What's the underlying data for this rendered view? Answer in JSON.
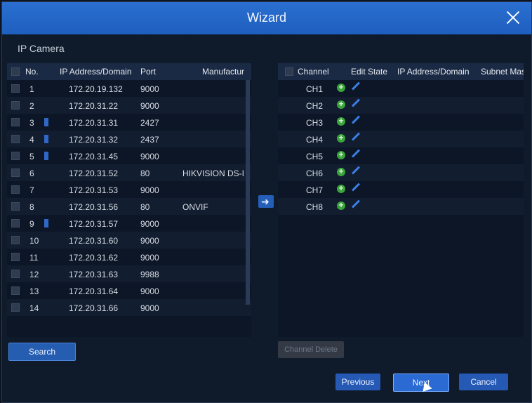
{
  "window": {
    "title": "Wizard"
  },
  "section_label": "IP Camera",
  "left_table": {
    "headers": [
      "No.",
      "IP Address/Domain",
      "Port",
      "Manufactur"
    ],
    "rows": [
      {
        "no": "1",
        "ip": "172.20.19.132",
        "port": "9000",
        "manufacturer": "",
        "badge": false
      },
      {
        "no": "2",
        "ip": "172.20.31.22",
        "port": "9000",
        "manufacturer": "",
        "badge": false
      },
      {
        "no": "3",
        "ip": "172.20.31.31",
        "port": "2427",
        "manufacturer": "",
        "badge": true
      },
      {
        "no": "4",
        "ip": "172.20.31.32",
        "port": "2437",
        "manufacturer": "",
        "badge": true
      },
      {
        "no": "5",
        "ip": "172.20.31.45",
        "port": "9000",
        "manufacturer": "",
        "badge": true
      },
      {
        "no": "6",
        "ip": "172.20.31.52",
        "port": "80",
        "manufacturer": "HIKVISION DS-I",
        "badge": false
      },
      {
        "no": "7",
        "ip": "172.20.31.53",
        "port": "9000",
        "manufacturer": "",
        "badge": false
      },
      {
        "no": "8",
        "ip": "172.20.31.56",
        "port": "80",
        "manufacturer": "ONVIF",
        "badge": false
      },
      {
        "no": "9",
        "ip": "172.20.31.57",
        "port": "9000",
        "manufacturer": "",
        "badge": true
      },
      {
        "no": "10",
        "ip": "172.20.31.60",
        "port": "9000",
        "manufacturer": "",
        "badge": false
      },
      {
        "no": "11",
        "ip": "172.20.31.62",
        "port": "9000",
        "manufacturer": "",
        "badge": false
      },
      {
        "no": "12",
        "ip": "172.20.31.63",
        "port": "9988",
        "manufacturer": "",
        "badge": false
      },
      {
        "no": "13",
        "ip": "172.20.31.64",
        "port": "9000",
        "manufacturer": "",
        "badge": false
      },
      {
        "no": "14",
        "ip": "172.20.31.66",
        "port": "9000",
        "manufacturer": "",
        "badge": false
      }
    ]
  },
  "right_table": {
    "headers": [
      "Channel",
      "Edit State",
      "IP Address/Domain",
      "Subnet Mas"
    ],
    "channels": [
      "CH1",
      "CH2",
      "CH3",
      "CH4",
      "CH5",
      "CH6",
      "CH7",
      "CH8"
    ]
  },
  "buttons": {
    "search": "Search",
    "channel_delete": "Channel Delete",
    "previous": "Previous",
    "next": "Next",
    "cancel": "Cancel"
  },
  "icons": [
    "close-icon",
    "add-icon",
    "edit-icon",
    "arrow-right-icon",
    "mouse-cursor-icon"
  ],
  "colors": {
    "accent": "#2a6ad2",
    "add_green": "#3aa53a",
    "edit_blue": "#3a7ee4",
    "bg": "#0f1a2b"
  }
}
